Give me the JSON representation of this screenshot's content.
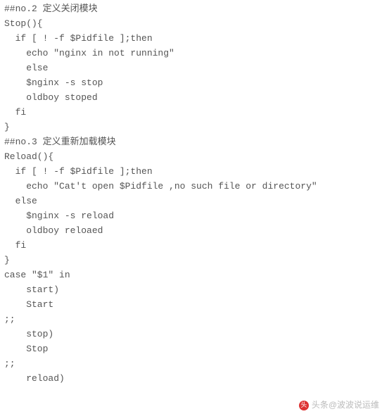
{
  "code_lines": [
    "##no.2 定义关闭模块",
    "Stop(){",
    "  if [ ! -f $Pidfile ];then",
    "    echo \"nginx in not running\"",
    "    else",
    "    $nginx -s stop",
    "    oldboy stoped",
    "  fi",
    "}",
    "##no.3 定义重新加载模块",
    "Reload(){",
    "  if [ ! -f $Pidfile ];then",
    "    echo \"Cat't open $Pidfile ,no such file or directory\"",
    "  else",
    "    $nginx -s reload",
    "    oldboy reloaed",
    "  fi",
    "}",
    "",
    "case \"$1\" in",
    "    start)",
    "    Start",
    ";;",
    "    stop)",
    "    Stop",
    ";;",
    "    reload)"
  ],
  "footer": {
    "source_label": "头条@波波说运维",
    "logo_glyph": "头"
  }
}
